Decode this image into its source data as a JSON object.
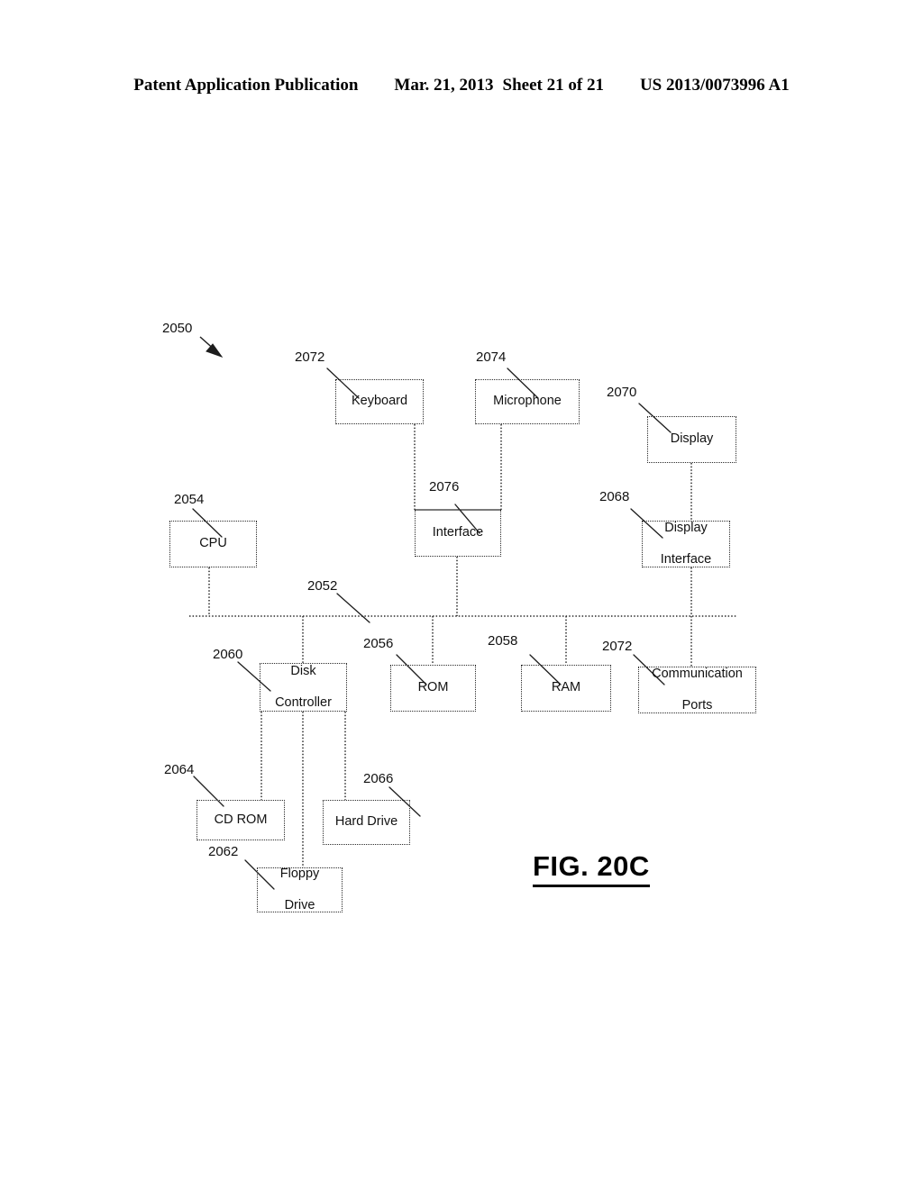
{
  "header": {
    "publication_label": "Patent Application Publication",
    "date": "Mar. 21, 2013",
    "sheet": "Sheet 21 of 21",
    "patent_number": "US 2013/0073996 A1"
  },
  "figure": {
    "caption": "FIG. 20C",
    "system_ref": "2050",
    "nodes": [
      {
        "id": "keyboard",
        "label": "Keyboard",
        "ref": "2072"
      },
      {
        "id": "microphone",
        "label": "Microphone",
        "ref": "2074"
      },
      {
        "id": "display",
        "label": "Display",
        "ref": "2070"
      },
      {
        "id": "interface",
        "label": "Interface",
        "ref": "2076"
      },
      {
        "id": "display-interface",
        "label_line1": "Display",
        "label_line2": "Interface",
        "ref": "2068"
      },
      {
        "id": "cpu",
        "label": "CPU",
        "ref": "2054"
      },
      {
        "id": "bus",
        "label": "",
        "ref": "2052"
      },
      {
        "id": "disk-controller",
        "label_line1": "Disk",
        "label_line2": "Controller",
        "ref": "2060"
      },
      {
        "id": "rom",
        "label": "ROM",
        "ref": "2056"
      },
      {
        "id": "ram",
        "label": "RAM",
        "ref": "2058"
      },
      {
        "id": "communication-ports",
        "label_line1": "Communication",
        "label_line2": "Ports",
        "ref": "2072"
      },
      {
        "id": "cd-rom",
        "label": "CD ROM",
        "ref": "2064"
      },
      {
        "id": "hard-drive",
        "label": "Hard Drive",
        "ref": "2066"
      },
      {
        "id": "floppy-drive",
        "label_line1": "Floppy",
        "label_line2": "Drive",
        "ref": "2062"
      }
    ],
    "colors": {
      "ink": "#111111",
      "line": "#2a2a2a",
      "background": "#ffffff"
    }
  }
}
